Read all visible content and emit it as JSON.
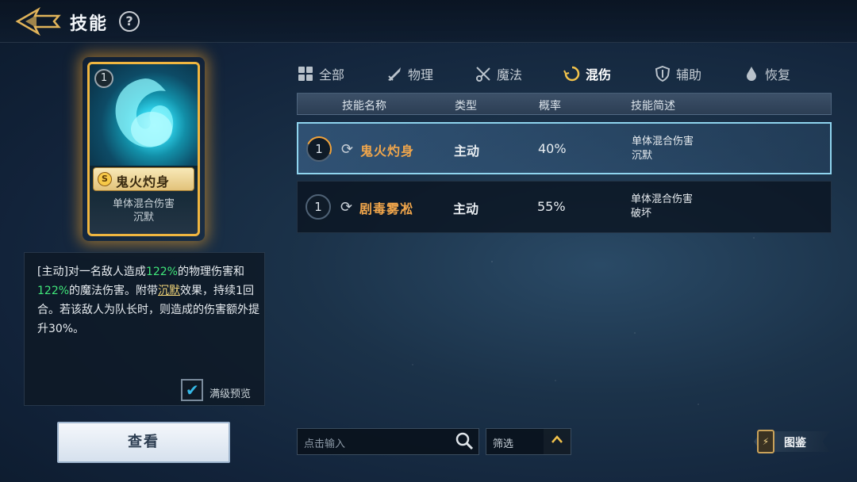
{
  "header": {
    "title": "技能",
    "help_glyph": "?"
  },
  "skill_card": {
    "level": "1",
    "rank_glyph": "S",
    "name": "鬼火灼身",
    "brief_line1": "单体混合伤害",
    "brief_line2": "沉默"
  },
  "description": {
    "p1": "[主动]对一名敌人造成",
    "v1": "122%",
    "p2": "的物理伤害和",
    "v2": "122%",
    "p3": "的魔法伤害。附带",
    "keyword": "沉默",
    "p4": "效果，持续1回合。若该敌人为队长时，则造成的伤害额外提升30%。",
    "max_preview_label": "满级预览",
    "max_preview_checked": true
  },
  "view_button": "查看",
  "tabs": [
    {
      "label": "全部",
      "icon": "grid-icon",
      "active": false
    },
    {
      "label": "物理",
      "icon": "sword-icon",
      "active": false
    },
    {
      "label": "魔法",
      "icon": "crossed-wands-icon",
      "active": false
    },
    {
      "label": "混伤",
      "icon": "swirl-icon",
      "active": true
    },
    {
      "label": "辅助",
      "icon": "shield-icon",
      "active": false
    },
    {
      "label": "恢复",
      "icon": "drop-icon",
      "active": false
    }
  ],
  "table": {
    "headers": {
      "name": "技能名称",
      "type": "类型",
      "rate": "概率",
      "brief": "技能简述"
    },
    "rows": [
      {
        "level": "1",
        "name": "鬼火灼身",
        "type": "主动",
        "rate": "40%",
        "brief1": "单体混合伤害",
        "brief2": "沉默",
        "selected": true
      },
      {
        "level": "1",
        "name": "剧毒雾凇",
        "type": "主动",
        "rate": "55%",
        "brief1": "单体混合伤害",
        "brief2": "破坏",
        "selected": false
      }
    ]
  },
  "search": {
    "placeholder": "点击输入"
  },
  "filter": {
    "label": "筛选"
  },
  "codex": {
    "label": "图鉴"
  },
  "colors": {
    "accent_gold": "#f1c24b",
    "skill_name_orange": "#f1a64b",
    "highlight_green": "#40e67a",
    "selection_border": "#8fd4ee"
  }
}
